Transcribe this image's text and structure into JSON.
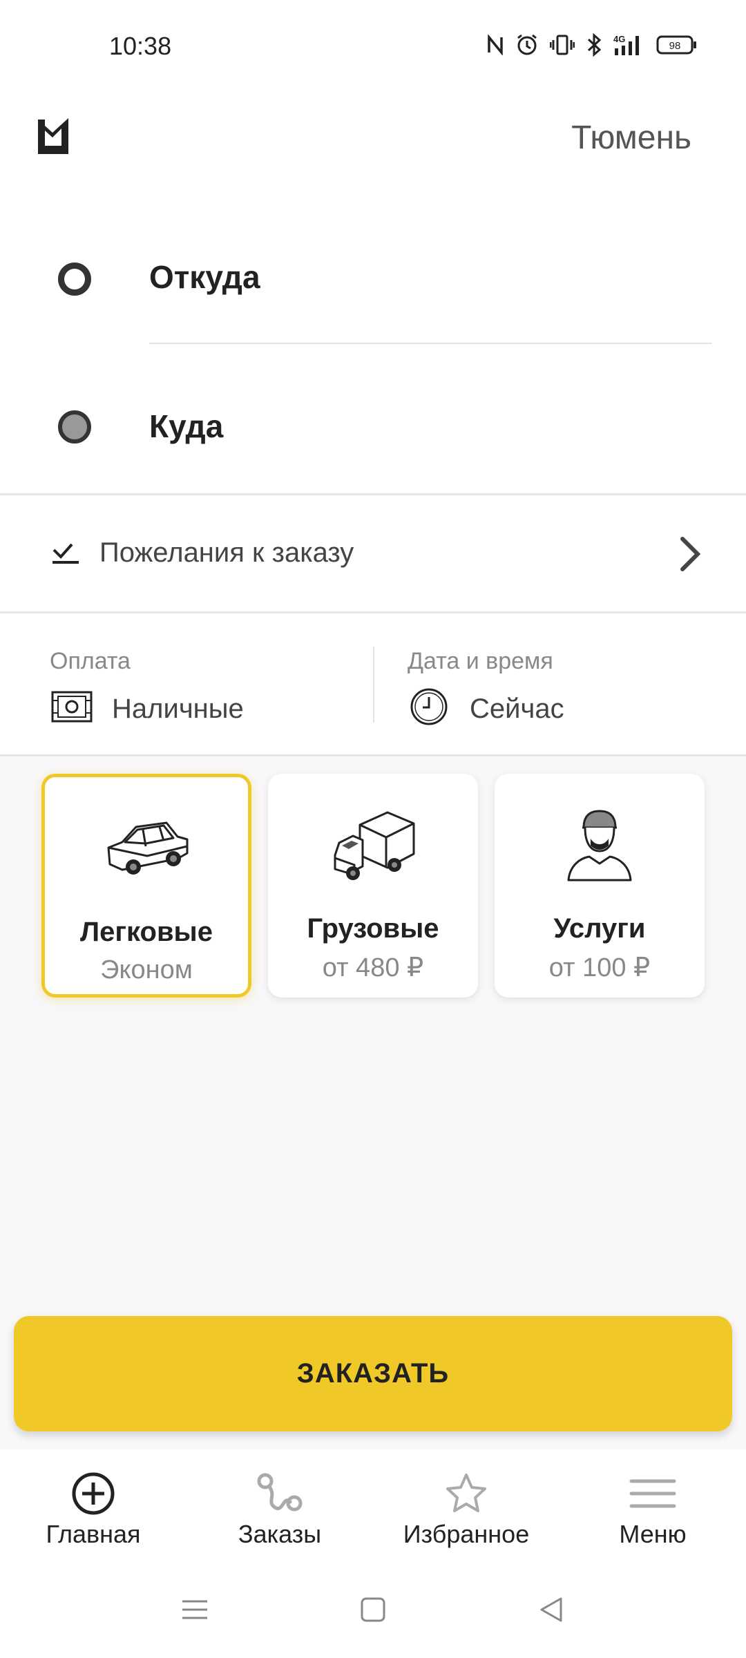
{
  "status": {
    "time": "10:38",
    "battery": "98"
  },
  "header": {
    "city": "Тюмень"
  },
  "route": {
    "from_label": "Откуда",
    "to_label": "Куда"
  },
  "wishes": {
    "label": "Пожелания к заказу"
  },
  "payment": {
    "caption": "Оплата",
    "value": "Наличные"
  },
  "datetime": {
    "caption": "Дата и время",
    "value": "Сейчас"
  },
  "categories": [
    {
      "title": "Легковые",
      "subtitle": "Эконом",
      "icon": "car-icon",
      "selected": true
    },
    {
      "title": "Грузовые",
      "subtitle": "от 480 ₽",
      "icon": "truck-icon",
      "selected": false
    },
    {
      "title": "Услуги",
      "subtitle": "от 100 ₽",
      "icon": "worker-icon",
      "selected": false
    }
  ],
  "order_button": {
    "label": "ЗАКАЗАТЬ"
  },
  "colors": {
    "accent": "#f0c929",
    "background": "#f8f7f9"
  },
  "bottom_nav": [
    {
      "label": "Главная",
      "icon": "plus-circle-icon",
      "active": true
    },
    {
      "label": "Заказы",
      "icon": "route-icon",
      "active": false
    },
    {
      "label": "Избранное",
      "icon": "star-icon",
      "active": false
    },
    {
      "label": "Меню",
      "icon": "menu-icon",
      "active": false
    }
  ]
}
